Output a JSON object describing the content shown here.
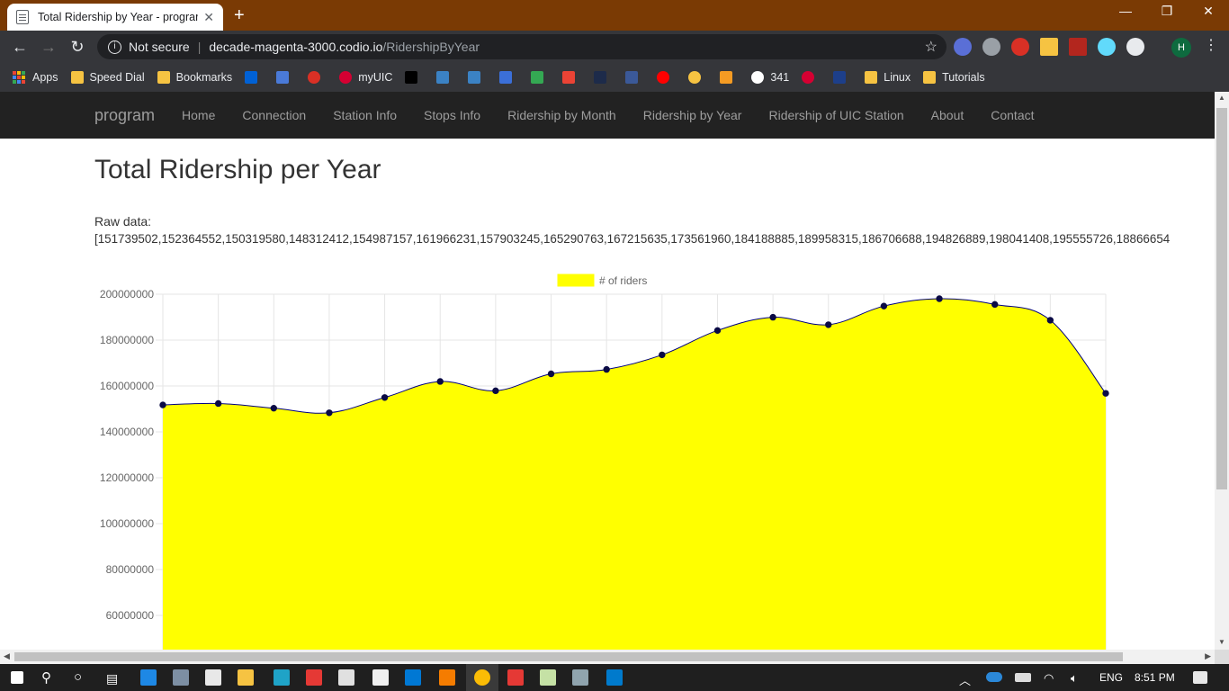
{
  "browser": {
    "tab_title": "Total Ridership by Year - program",
    "tab_close": "✕",
    "new_tab": "+",
    "security": "Not secure",
    "url_host": "decade-magenta-3000.codio.io",
    "url_path": "/RidershipByYear",
    "profile_initial": "H",
    "window_minimize": "—",
    "window_restore": "❐",
    "window_close": "✕"
  },
  "bookmarks": [
    {
      "label": "Apps",
      "icon": "apps-grid-icon"
    },
    {
      "label": "Speed Dial",
      "icon": "folder-icon"
    },
    {
      "label": "Bookmarks",
      "icon": "folder-icon"
    },
    {
      "label": "",
      "icon": "box-icon",
      "color": "#0061d5"
    },
    {
      "label": "",
      "icon": "page-icon",
      "color": "#4a7ad8"
    },
    {
      "label": "",
      "icon": "red-circle-icon",
      "color": "#d93025"
    },
    {
      "label": "myUIC",
      "icon": "uic-icon",
      "color": "#d50032"
    },
    {
      "label": "",
      "icon": "blackboard-icon",
      "color": "#000000"
    },
    {
      "label": "",
      "icon": "ic-icon",
      "color": "#3b82c4"
    },
    {
      "label": "",
      "icon": "p-icon",
      "color": "#3b82c4"
    },
    {
      "label": "",
      "icon": "c-icon",
      "color": "#3b6fd8"
    },
    {
      "label": "",
      "icon": "drive-icon",
      "color": "#34a853"
    },
    {
      "label": "",
      "icon": "gmail-icon",
      "color": "#ea4335"
    },
    {
      "label": "",
      "icon": "v-icon",
      "color": "#1d2b4a"
    },
    {
      "label": "",
      "icon": "facebook-icon",
      "color": "#3b5998"
    },
    {
      "label": "",
      "icon": "youtube-icon",
      "color": "#ff0000"
    },
    {
      "label": "",
      "icon": "smiley-icon",
      "color": "#f6c342"
    },
    {
      "label": "",
      "icon": "zy-icon",
      "color": "#f59b23"
    },
    {
      "label": "341",
      "icon": "globe-icon",
      "color": "#ffffff"
    },
    {
      "label": "",
      "icon": "uic-icon",
      "color": "#d50032"
    },
    {
      "label": "",
      "icon": "uic-logo-icon",
      "color": "#1d3f8a"
    },
    {
      "label": "Linux",
      "icon": "folder-icon"
    },
    {
      "label": "Tutorials",
      "icon": "folder-icon"
    }
  ],
  "site_nav": {
    "brand": "program",
    "links": [
      "Home",
      "Connection",
      "Station Info",
      "Stops Info",
      "Ridership by Month",
      "Ridership by Year",
      "Ridership of UIC Station",
      "About",
      "Contact"
    ]
  },
  "page": {
    "title": "Total Ridership per Year",
    "raw_label": "Raw data:",
    "raw_values": "[151739502,152364552,150319580,148312412,154987157,161966231,157903245,165290763,167215635,173561960,184188885,189958315,186706688,194826889,198041408,195555726,18866654"
  },
  "chart_data": {
    "type": "area",
    "legend": "# of riders",
    "legend_position": "top-center",
    "fill_color": "#ffff00",
    "line_color": "#000080",
    "y_ticks": [
      "200000000",
      "180000000",
      "160000000",
      "140000000",
      "120000000",
      "100000000",
      "80000000",
      "60000000"
    ],
    "ylim": [
      60000000,
      200000000
    ],
    "grid": true,
    "values": [
      151739502,
      152364552,
      150319580,
      148312412,
      154987157,
      161966231,
      157903245,
      165290763,
      167215635,
      173561960,
      184188885,
      189958315,
      186706688,
      194826889,
      198041408,
      195555726,
      188666545,
      156800000
    ]
  },
  "taskbar": {
    "language": "ENG",
    "time": "8:51 PM"
  }
}
